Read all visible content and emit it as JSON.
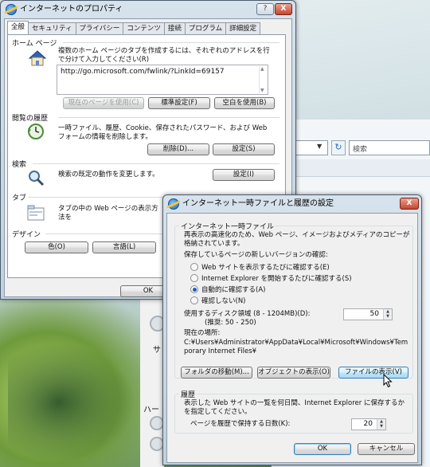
{
  "background": {
    "search_placeholder": "検索",
    "side_text_1": "サ",
    "side_text_2": "ハー"
  },
  "properties": {
    "title": "インターネットのプロパティ",
    "help_button": "?",
    "close_button": "X",
    "tabs": [
      "全般",
      "セキュリティ",
      "プライバシー",
      "コンテンツ",
      "接続",
      "プログラム",
      "詳細設定"
    ],
    "home": {
      "heading": "ホーム ページ",
      "description": "複数のホーム ページのタブを作成するには、それぞれのアドレスを行で分けて入力してください(R)",
      "url": "http://go.microsoft.com/fwlink/?LinkId=69157",
      "use_current": "現在のページを使用(C)",
      "use_default": "標準設定(F)",
      "use_blank": "空白を使用(B)"
    },
    "history": {
      "heading": "閲覧の履歴",
      "description": "一時ファイル、履歴、Cookie、保存されたパスワード、および Web フォームの情報を削除します。",
      "delete": "削除(D)...",
      "settings": "設定(S)"
    },
    "search": {
      "heading": "検索",
      "description": "検索の既定の動作を変更します。",
      "settings": "設定(I)"
    },
    "tabs_section": {
      "heading": "タブ",
      "description": "タブの中の Web ページの表示方法を"
    },
    "design": {
      "heading": "デザイン",
      "colors": "色(O)",
      "languages": "言語(L)"
    },
    "ok": "OK"
  },
  "cache": {
    "title": "インターネット一時ファイルと履歴の設定",
    "close_button": "X",
    "temp_group": {
      "title": "インターネット一時ファイル",
      "description": "再表示の高速化のため、Web ページ、イメージおよびメディアのコピーが格納されています。",
      "check_label": "保存しているページの新しいバージョンの確認:",
      "options": [
        "Web サイトを表示するたびに確認する(E)",
        "Internet Explorer を開始するたびに確認する(S)",
        "自動的に確認する(A)",
        "確認しない(N)"
      ],
      "selected_index": 2,
      "disk_label": "使用するディスク領域 (8 - 1204MB)(D):",
      "disk_recommended": "(推奨: 50 - 250)",
      "disk_value": "50",
      "location_label": "現在の場所:",
      "location_path": "C:¥Users¥Administrator¥AppData¥Local¥Microsoft¥Windows¥Temporary Internet Files¥",
      "move_folder": "フォルダの移動(M)...",
      "view_objects": "オブジェクトの表示(O)",
      "view_files": "ファイルの表示(V)"
    },
    "history_group": {
      "title": "履歴",
      "description": "表示した Web サイトの一覧を何日間、Internet Explorer に保存するかを指定してください。",
      "days_label": "ページを履歴で保持する日数(K):",
      "days_value": "20"
    },
    "ok": "OK",
    "cancel": "キャンセル"
  }
}
